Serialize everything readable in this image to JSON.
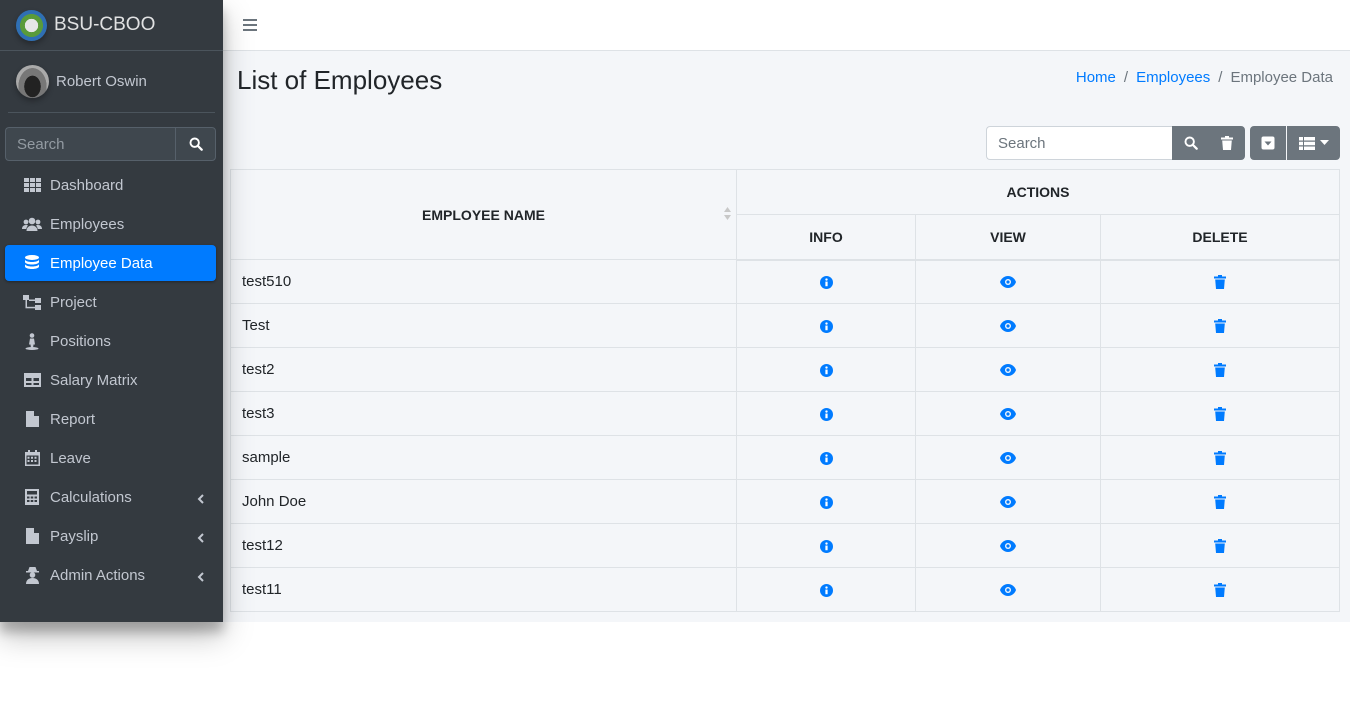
{
  "brand": {
    "name": "BSU-CBOO"
  },
  "user": {
    "name": "Robert Oswin"
  },
  "sidebar_search": {
    "placeholder": "Search"
  },
  "nav": [
    {
      "label": "Dashboard",
      "icon": "grid-icon",
      "active": false,
      "has_caret": false
    },
    {
      "label": "Employees",
      "icon": "users-icon",
      "active": false,
      "has_caret": false
    },
    {
      "label": "Employee Data",
      "icon": "database-icon",
      "active": true,
      "has_caret": false
    },
    {
      "label": "Project",
      "icon": "sitemap-icon",
      "active": false,
      "has_caret": false
    },
    {
      "label": "Positions",
      "icon": "person-icon",
      "active": false,
      "has_caret": false
    },
    {
      "label": "Salary Matrix",
      "icon": "table-icon",
      "active": false,
      "has_caret": false
    },
    {
      "label": "Report",
      "icon": "file-icon",
      "active": false,
      "has_caret": false
    },
    {
      "label": "Leave",
      "icon": "calendar-icon",
      "active": false,
      "has_caret": false
    },
    {
      "label": "Calculations",
      "icon": "calculator-icon",
      "active": false,
      "has_caret": true
    },
    {
      "label": "Payslip",
      "icon": "file-alt-icon",
      "active": false,
      "has_caret": true
    },
    {
      "label": "Admin Actions",
      "icon": "user-secret-icon",
      "active": false,
      "has_caret": true
    }
  ],
  "page": {
    "title": "List of Employees"
  },
  "breadcrumb": {
    "home": "Home",
    "employees": "Employees",
    "current": "Employee Data"
  },
  "toolbar": {
    "search_placeholder": "Search"
  },
  "table": {
    "headers": {
      "name": "EMPLOYEE NAME",
      "actions": "ACTIONS",
      "info": "INFO",
      "view": "VIEW",
      "delete": "DELETE"
    },
    "rows": [
      "test510",
      "Test",
      "test2",
      "test3",
      "sample",
      "John Doe",
      "test12",
      "test11"
    ]
  },
  "colors": {
    "sidebar_bg": "#343a40",
    "accent": "#007bff",
    "content_bg": "#f4f6f9",
    "secondary": "#6c757d"
  }
}
